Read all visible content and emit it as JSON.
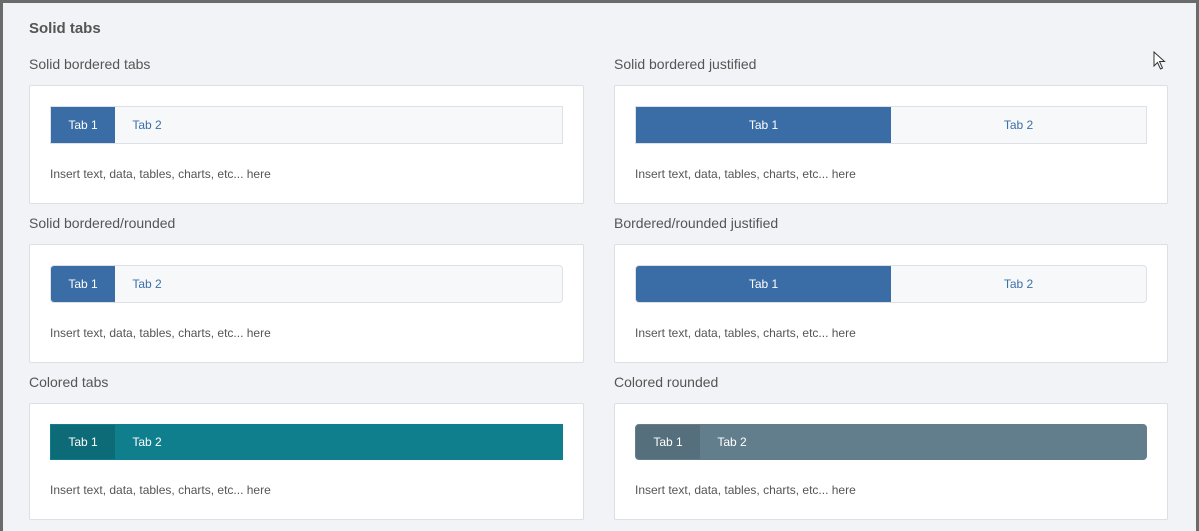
{
  "page_title": "Solid tabs",
  "sections": [
    {
      "title": "Solid bordered tabs",
      "tabs": [
        "Tab 1",
        "Tab 2"
      ],
      "content": "Insert text, data, tables, charts, etc... here",
      "active_tab": "Tab 1"
    },
    {
      "title": "Solid bordered justified",
      "tabs": [
        "Tab 1",
        "Tab 2"
      ],
      "content": "Insert text, data, tables, charts, etc... here",
      "active_tab": "Tab 1"
    },
    {
      "title": "Solid bordered/rounded",
      "tabs": [
        "Tab 1",
        "Tab 2"
      ],
      "content": "Insert text, data, tables, charts, etc... here",
      "active_tab": "Tab 1"
    },
    {
      "title": "Bordered/rounded justified",
      "tabs": [
        "Tab 1",
        "Tab 2"
      ],
      "content": "Insert text, data, tables, charts, etc... here",
      "active_tab": "Tab 1"
    },
    {
      "title": "Colored tabs",
      "tabs": [
        "Tab 1",
        "Tab 2"
      ],
      "content": "Insert text, data, tables, charts, etc... here",
      "active_tab": "Tab 1"
    },
    {
      "title": "Colored rounded",
      "tabs": [
        "Tab 1",
        "Tab 2"
      ],
      "content": "Insert text, data, tables, charts, etc... here",
      "active_tab": "Tab 1"
    }
  ],
  "colors": {
    "primary": "#3a6ca6",
    "teal": "#0f7f8e",
    "teal_active": "#0d6b78",
    "slate": "#627d8c",
    "slate_active": "#556f7d",
    "background": "#f1f3f6"
  },
  "icons": {
    "cursor": "mouse-pointer-icon"
  }
}
